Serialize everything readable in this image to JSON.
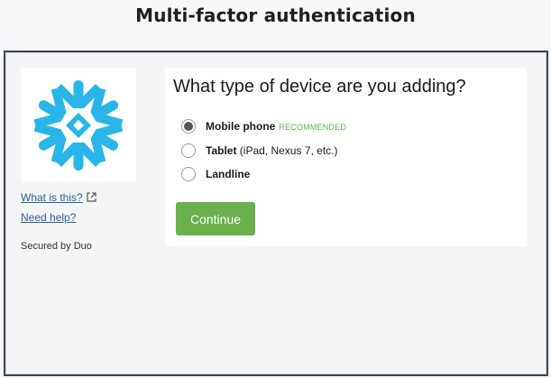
{
  "page": {
    "title": "Multi-factor authentication"
  },
  "sidebar": {
    "what_is_this": "What is this?",
    "need_help": "Need help?",
    "secured_by": "Secured by Duo",
    "logo_icon": "snowflake-logo",
    "logo_color": "#29b5e8"
  },
  "prompt": {
    "heading": "What type of device are you adding?",
    "options": [
      {
        "label": "Mobile phone",
        "extra": "RECOMMENDED",
        "selected": true
      },
      {
        "label": "Tablet",
        "extra": " (iPad, Nexus 7, etc.)",
        "selected": false
      },
      {
        "label": "Landline",
        "extra": "",
        "selected": false
      }
    ],
    "continue_label": "Continue",
    "accent_color": "#6ab04c"
  }
}
